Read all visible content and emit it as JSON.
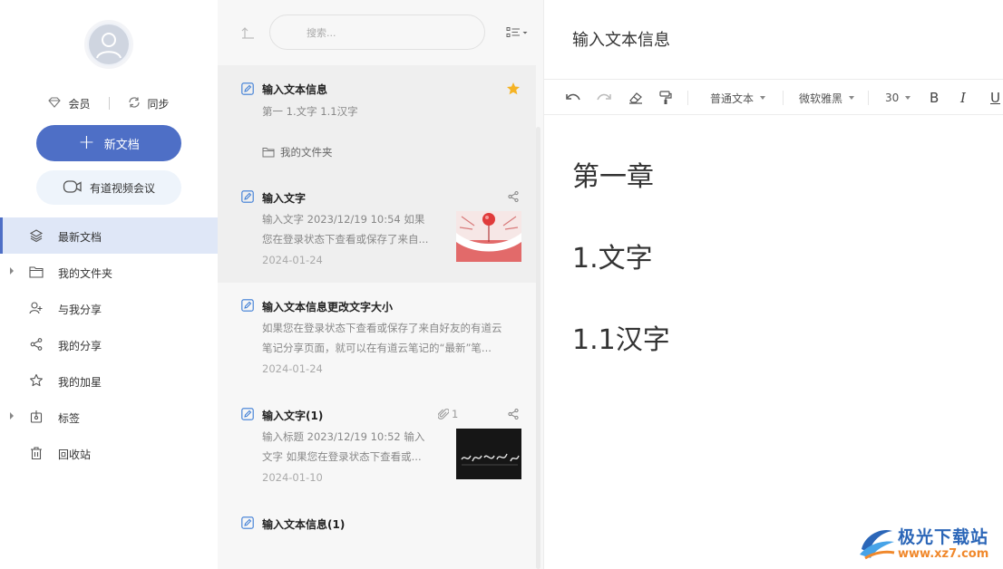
{
  "sidebar": {
    "member_label": "会员",
    "sync_label": "同步",
    "new_doc_label": "新文档",
    "meeting_label": "有道视频会议",
    "nav": [
      {
        "label": "最新文档",
        "icon": "layers-icon"
      },
      {
        "label": "我的文件夹",
        "icon": "folder-icon"
      },
      {
        "label": "与我分享",
        "icon": "shared-with-me-icon"
      },
      {
        "label": "我的分享",
        "icon": "share-icon"
      },
      {
        "label": "我的加星",
        "icon": "star-icon"
      },
      {
        "label": "标签",
        "icon": "tag-icon"
      },
      {
        "label": "回收站",
        "icon": "trash-icon"
      }
    ]
  },
  "list": {
    "search_placeholder": "搜索...",
    "notes": [
      {
        "title": "输入文本信息",
        "snippet": "第一 1.文字 1.1汉字",
        "folder": "我的文件夹"
      },
      {
        "title": "输入文字",
        "snippet1": "输入文字 2023/12/19 10:54 如果",
        "snippet2": "您在登录状态下查看或保存了来自...",
        "date": "2024-01-24"
      },
      {
        "title": "输入文本信息更改文字大小",
        "snippet1": "如果您在登录状态下查看或保存了来自好友的有道云",
        "snippet2": "笔记分享页面，就可以在有道云笔记的“最新”笔...",
        "date": "2024-01-24"
      },
      {
        "title": "输入文字(1)",
        "attach_count": "1",
        "snippet1": "输入标题 2023/12/19 10:52 输入",
        "snippet2": "文字 如果您在登录状态下查看或...",
        "date": "2024-01-10"
      },
      {
        "title": "输入文本信息(1)"
      }
    ]
  },
  "editor": {
    "title": "输入文本信息",
    "toolbar": {
      "paragraph_style": "普通文本",
      "font": "微软雅黑",
      "font_size": "30",
      "bold": "B",
      "italic": "I",
      "underline": "U"
    },
    "content": {
      "heading1": "第一章",
      "heading2": "1.文字",
      "heading3": "1.1汉字"
    }
  },
  "watermark": {
    "name": "极光下载站",
    "url": "www.xz7.com"
  },
  "colors": {
    "primary": "#4e6fc6",
    "active_nav_bg": "#dfe7f7",
    "star": "#f5b324"
  }
}
